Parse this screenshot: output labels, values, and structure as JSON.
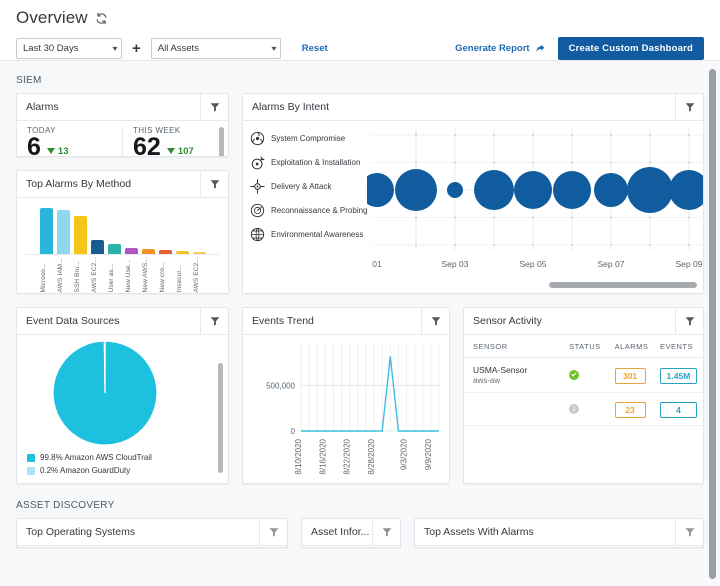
{
  "header": {
    "title": "Overview",
    "refresh_icon": "refresh-icon",
    "date_filter": {
      "value": "Last 30 Days",
      "caret": "chevron-down-icon"
    },
    "plus": "+",
    "asset_filter": {
      "value": "All Assets",
      "caret": "chevron-down-icon"
    },
    "reset_label": "Reset",
    "generate_report_label": "Generate Report",
    "generate_report_icon": "share-arrow-icon",
    "create_dashboard_label": "Create Custom Dashboard",
    "accent_color": "#115ca0",
    "link_color": "#1f6bb5"
  },
  "sections": {
    "siem_label": "SIEM",
    "asset_discovery_label": "ASSET DISCOVERY"
  },
  "alarms_card": {
    "title": "Alarms",
    "filter_icon": "funnel-icon",
    "today": {
      "label": "TODAY",
      "value": "6",
      "delta": "13",
      "direction": "down",
      "delta_color": "#2e8b2e"
    },
    "this_week": {
      "label": "THIS WEEK",
      "value": "62",
      "delta": "107",
      "direction": "down",
      "delta_color": "#2e8b2e"
    }
  },
  "method_card": {
    "title": "Top Alarms By Method",
    "filter_icon": "funnel-icon",
    "chart_data": {
      "type": "bar",
      "title": "Top Alarms By Method",
      "xlabel": "",
      "ylabel": "",
      "categories": [
        "Microso...",
        "AWS IAM...",
        "SSH Bru...",
        "AWS EC2...",
        "User as...",
        "New Use...",
        "New AWS...",
        "New cro...",
        "Insecur...",
        "AWS EC2..."
      ],
      "values": [
        46,
        44,
        38,
        14,
        10,
        6,
        5,
        4,
        3,
        2
      ],
      "ylim": [
        0,
        48
      ],
      "colors": [
        "#2ab6da",
        "#8ed8ee",
        "#f5c518",
        "#185c90",
        "#2bb3a8",
        "#b455c4",
        "#f29423",
        "#e0612f",
        "#f2c12e",
        "#f0cf67"
      ]
    }
  },
  "intent_card": {
    "title": "Alarms By Intent",
    "filter_icon": "funnel-icon",
    "intents": [
      {
        "label": "System Compromise",
        "icon": "biohazard-icon"
      },
      {
        "label": "Exploitation & Installation",
        "icon": "bomb-icon"
      },
      {
        "label": "Delivery & Attack",
        "icon": "crosshair-icon"
      },
      {
        "label": "Reconnaissance & Probing",
        "icon": "radar-icon"
      },
      {
        "label": "Environmental Awareness",
        "icon": "globe-icon"
      }
    ],
    "chart_data": {
      "type": "scatter",
      "title": "Alarms By Intent",
      "xlabel": "",
      "ylabel": "",
      "bubble_color": "#115c9e",
      "x_ticks": [
        "01",
        "Sep 03",
        "Sep 05",
        "Sep 07",
        "Sep 09"
      ],
      "y_categories": [
        "System Compromise",
        "Exploitation & Installation",
        "Delivery & Attack",
        "Reconnaissance & Probing",
        "Environmental Awareness"
      ],
      "points": [
        {
          "x": 0,
          "row": 2,
          "size": 17
        },
        {
          "x": 1,
          "row": 2,
          "size": 21
        },
        {
          "x": 2,
          "row": 2,
          "size": 8
        },
        {
          "x": 3,
          "row": 2,
          "size": 20
        },
        {
          "x": 4,
          "row": 2,
          "size": 19
        },
        {
          "x": 5,
          "row": 2,
          "size": 19
        },
        {
          "x": 6,
          "row": 2,
          "size": 17
        },
        {
          "x": 7,
          "row": 2,
          "size": 23
        },
        {
          "x": 8,
          "row": 2,
          "size": 20
        },
        {
          "x": 9,
          "row": 2,
          "size": 11
        },
        {
          "x": 9,
          "row": 0,
          "size": 2
        }
      ]
    }
  },
  "event_data_sources": {
    "title": "Event Data Sources",
    "filter_icon": "funnel-icon",
    "chart_data": {
      "type": "pie",
      "title": "Event Data Sources",
      "labels": [
        "Amazon AWS CloudTrail",
        "Amazon GuardDuty"
      ],
      "values": [
        99.8,
        0.2
      ],
      "colors": [
        "#1ec0e0",
        "#a8e6f5"
      ],
      "legend_position": "bottom"
    },
    "legend": [
      {
        "percent": "99.8%",
        "name": "Amazon AWS CloudTrail",
        "color": "#1ec0e0"
      },
      {
        "percent": "0.2%",
        "name": "Amazon GuardDuty",
        "color": "#a8e6f5"
      }
    ]
  },
  "events_trend": {
    "title": "Events Trend",
    "filter_icon": "funnel-icon",
    "chart_data": {
      "type": "line",
      "title": "Events Trend",
      "xlabel": "",
      "ylabel": "",
      "line_color": "#3cbfe0",
      "y_ticks": [
        "0",
        "500,000"
      ],
      "ylim": [
        0,
        900000
      ],
      "x_ticks": [
        "8/10/2020",
        "8/16/2020",
        "8/22/2020",
        "8/28/2020",
        "9/3/2020",
        "9/9/2020"
      ],
      "x": [
        "8/10/2020",
        "8/12/2020",
        "8/14/2020",
        "8/16/2020",
        "8/18/2020",
        "8/20/2020",
        "8/22/2020",
        "8/24/2020",
        "8/26/2020",
        "8/28/2020",
        "8/30/2020",
        "8/31/2020",
        "9/1/2020",
        "9/3/2020",
        "9/5/2020",
        "9/7/2020",
        "9/9/2020",
        "9/11/2020"
      ],
      "values": [
        0,
        0,
        0,
        0,
        0,
        0,
        0,
        0,
        0,
        0,
        0,
        820000,
        0,
        0,
        0,
        0,
        0,
        0
      ]
    }
  },
  "sensor_activity": {
    "title": "Sensor Activity",
    "filter_icon": "funnel-icon",
    "columns": [
      "SENSOR",
      "STATUS",
      "ALARMS",
      "EVENTS"
    ],
    "rows": [
      {
        "sensor": "USMA-Sensor",
        "sensor_sub": "aws-aw",
        "status": "ok",
        "alarms": "301",
        "events": "1.45M"
      },
      {
        "sensor": "",
        "sensor_sub": "",
        "status": "idle",
        "alarms": "23",
        "events": "4"
      }
    ],
    "alarm_color": "#e8a33d",
    "event_color": "#27a3bf",
    "ok_color": "#72c02c"
  },
  "asset_discovery": {
    "cards": [
      {
        "title": "Top Operating Systems",
        "filter_icon": "funnel-icon"
      },
      {
        "title": "Asset Infor...",
        "filter_icon": "funnel-icon"
      },
      {
        "title": "Top Assets With Alarms",
        "filter_icon": "funnel-icon"
      }
    ]
  }
}
